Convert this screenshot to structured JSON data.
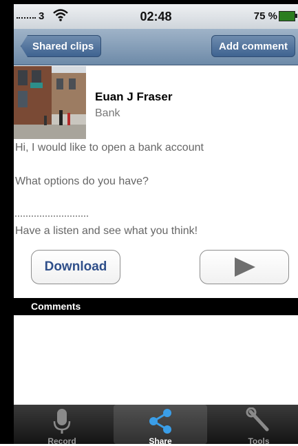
{
  "status_bar": {
    "carrier": "3",
    "time": "02:48",
    "battery": "75 %"
  },
  "nav": {
    "back_label": "Shared clips",
    "add_comment_label": "Add comment"
  },
  "clip": {
    "author": "Euan J Fraser",
    "category": "Bank",
    "messages": [
      "Hi, I would like to open a bank account",
      "What options do you have?",
      "Have a listen and see what you think!"
    ],
    "download_label": "Download"
  },
  "comments": {
    "header": "Comments"
  },
  "tabs": [
    {
      "label": "Record",
      "icon": "microphone-icon",
      "active": false
    },
    {
      "label": "Share",
      "icon": "share-icon",
      "active": true
    },
    {
      "label": "Tools",
      "icon": "wrench-icon",
      "active": false
    }
  ],
  "colors": {
    "nav_bar": "#7d97b5",
    "download_text": "#2f4f8a",
    "share_icon": "#3a9ee8",
    "battery": "#2b7d1f"
  }
}
